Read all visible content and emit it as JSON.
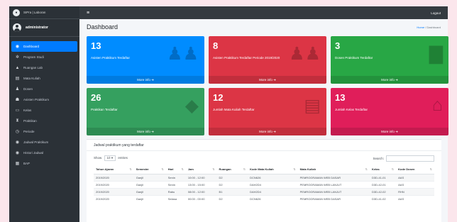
{
  "app": {
    "brand": "SIPra | Laboran",
    "user": "administrator",
    "logout_label": "Logout"
  },
  "sidebar": {
    "items": [
      {
        "label": "Dashboard",
        "icon": "gauge-icon"
      },
      {
        "label": "Program Studi",
        "icon": "gear-icon"
      },
      {
        "label": "Ruangan Lab",
        "icon": "building-icon"
      },
      {
        "label": "Mata Kuliah",
        "icon": "book-icon"
      },
      {
        "label": "Dosen",
        "icon": "users-icon"
      },
      {
        "label": "Asisten Praktikum",
        "icon": "user-check-icon"
      },
      {
        "label": "Kelas",
        "icon": "chalkboard-icon"
      },
      {
        "label": "Praktikan",
        "icon": "flask-icon"
      },
      {
        "label": "Periode",
        "icon": "clock-icon"
      },
      {
        "label": "Jadwal Praktikum",
        "icon": "calendar-icon"
      },
      {
        "label": "Histori Jadwal",
        "icon": "history-icon"
      },
      {
        "label": "BAP",
        "icon": "document-icon"
      }
    ]
  },
  "header": {
    "title": "Dashboard",
    "breadcrumb_home": "Home",
    "breadcrumb_sep": "/",
    "breadcrumb_current": "Dashboard"
  },
  "boxes": [
    {
      "value": "13",
      "label": "Asisten Praktikum Terdaftar",
      "more": "More info",
      "color": "#008cff",
      "icon": "users-icon"
    },
    {
      "value": "8",
      "label": "Asisten Praktikum Terdaftar Periode 2019/2020",
      "more": "More info",
      "color": "#dc3545",
      "icon": "users-icon"
    },
    {
      "value": "3",
      "label": "Dosen Praktikum Terdaftar",
      "more": "More info",
      "color": "#28a745",
      "icon": "briefcase-icon"
    },
    {
      "value": "26",
      "label": "Praktikan Terdaftar",
      "more": "More info",
      "color": "#35a05f",
      "icon": "graduation-cap-icon"
    },
    {
      "value": "12",
      "label": "Jumlah Mata Kuliah Terdaftar",
      "more": "More info",
      "color": "#dc3545",
      "icon": "book-icon"
    },
    {
      "value": "13",
      "label": "Jumlah Kelas Terdaftar",
      "more": "More info",
      "color": "#e01e5a",
      "icon": "school-icon"
    }
  ],
  "card": {
    "title": "Jadwal praktikum yang terdaftar",
    "show_label": "Show",
    "entries_value": "10",
    "entries_label": "entries",
    "search_label": "Search:",
    "columns": [
      "Tahun Ajaran",
      "Semester",
      "Hari",
      "Jam",
      "Ruangan",
      "Kode Mata Kuliah",
      "Mata Kuliah",
      "Kelas",
      "Kode Dosen"
    ],
    "rows": [
      [
        "2019/2020",
        "Ganjil",
        "Senin",
        "10:00 - 12:00",
        "D2",
        "DCN626",
        "PEMROGRAMAN WEB DASAR",
        "D3D-41-01",
        "AAS"
      ],
      [
        "2019/2020",
        "Ganjil",
        "Senin",
        "13:00 - 15:00",
        "D2",
        "DAH2D4",
        "PEMROGRAMAN WEB LANJUT",
        "D3D-42-01",
        "AAS"
      ],
      [
        "2019/2020",
        "Ganjil",
        "Rabu",
        "08:00 - 12:00",
        "B1",
        "DAH2D4",
        "PEMROGRAMAN WEB LANJUT",
        "D3D-42-02",
        "RHN"
      ],
      [
        "2019/2020",
        "Ganjil",
        "Selasa",
        "00:00 - 00:00",
        "D2",
        "DCN626",
        "PEMROGRAMAN WEB DASAR",
        "D3D-41-02",
        "AAS"
      ]
    ]
  },
  "colors": {
    "sidebar": "#2b3137",
    "topbar": "#343a40",
    "accent": "#007bff"
  }
}
